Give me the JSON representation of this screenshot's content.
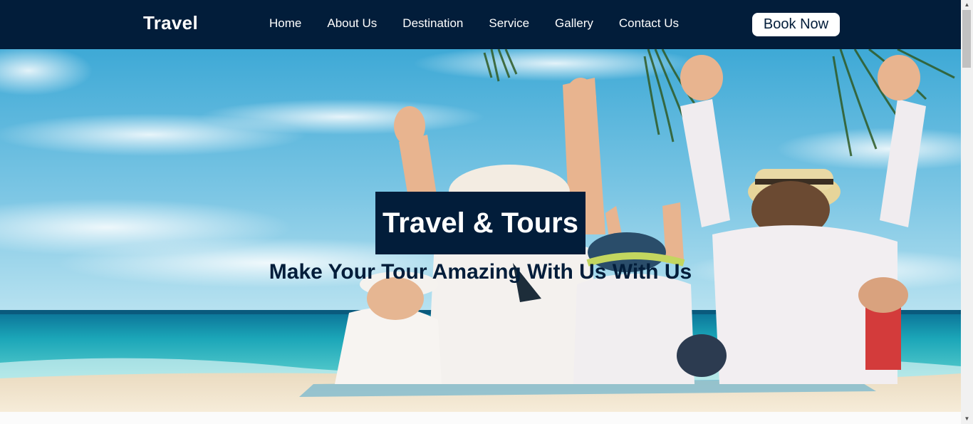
{
  "navbar": {
    "brand": "Travel",
    "links": [
      {
        "label": "Home"
      },
      {
        "label": "About Us"
      },
      {
        "label": "Destination"
      },
      {
        "label": "Service"
      },
      {
        "label": "Gallery"
      },
      {
        "label": "Contact Us"
      }
    ],
    "cta_label": "Book Now"
  },
  "hero": {
    "title": "Travel & Tours",
    "subtitle": "Make Your Tour Amazing With Us With Us",
    "image": "beach-family-hero-image"
  },
  "scrollbar": {
    "up_icon": "triangle-up-icon",
    "down_icon": "triangle-down-icon",
    "up_glyph": "▲",
    "down_glyph": "▼"
  },
  "colors": {
    "navy": "#021d3a",
    "white": "#ffffff",
    "page_bg": "#fbfbfb"
  }
}
